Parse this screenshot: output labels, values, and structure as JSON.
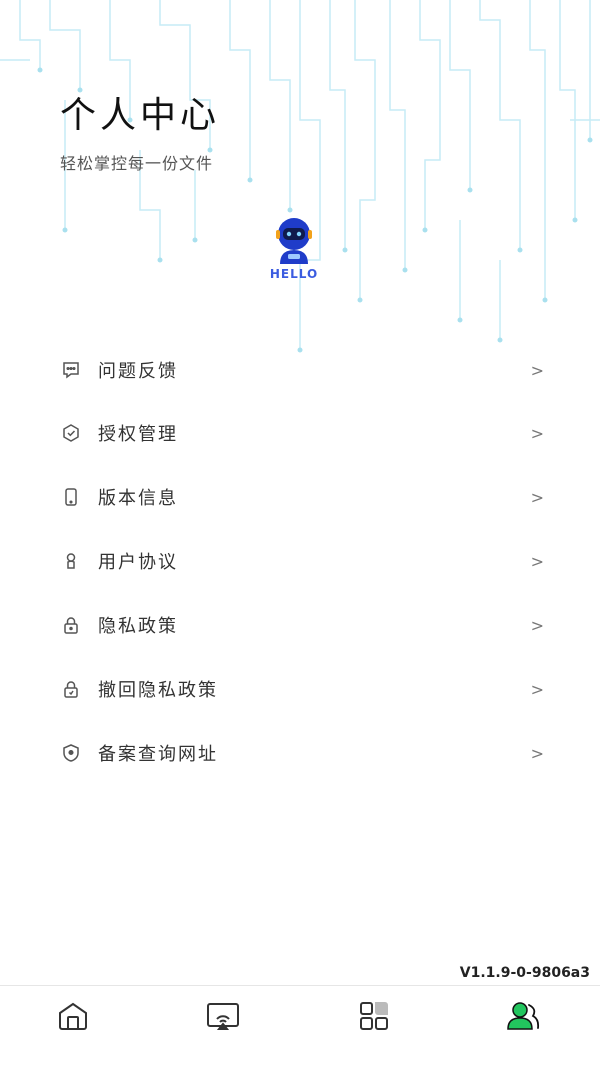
{
  "header": {
    "title": "个人中心",
    "subtitle": "轻松掌控每一份文件"
  },
  "mascot": {
    "label": "HELLO",
    "icon": "robot-icon"
  },
  "menu": {
    "items": [
      {
        "label": "问题反馈",
        "icon": "feedback-icon",
        "arrow": ">"
      },
      {
        "label": "授权管理",
        "icon": "authorization-icon",
        "arrow": ">"
      },
      {
        "label": "版本信息",
        "icon": "phone-icon",
        "arrow": ">"
      },
      {
        "label": "用户协议",
        "icon": "user-agreement-icon",
        "arrow": ">"
      },
      {
        "label": "隐私政策",
        "icon": "lock-icon",
        "arrow": ">"
      },
      {
        "label": "撤回隐私政策",
        "icon": "unlock-icon",
        "arrow": ">"
      },
      {
        "label": "备案查询网址",
        "icon": "shield-icon",
        "arrow": ">"
      }
    ]
  },
  "version": "V1.1.9-0-9806a3",
  "tabbar": {
    "tabs": [
      {
        "icon": "home-icon",
        "active": false
      },
      {
        "icon": "cast-screen-icon",
        "active": false
      },
      {
        "icon": "apps-grid-icon",
        "active": false
      },
      {
        "icon": "profile-icon",
        "active": true
      }
    ]
  },
  "colors": {
    "accent": "#22c55e",
    "mascot_blue": "#3b5ce0",
    "circuit": "#bfe9f3"
  }
}
